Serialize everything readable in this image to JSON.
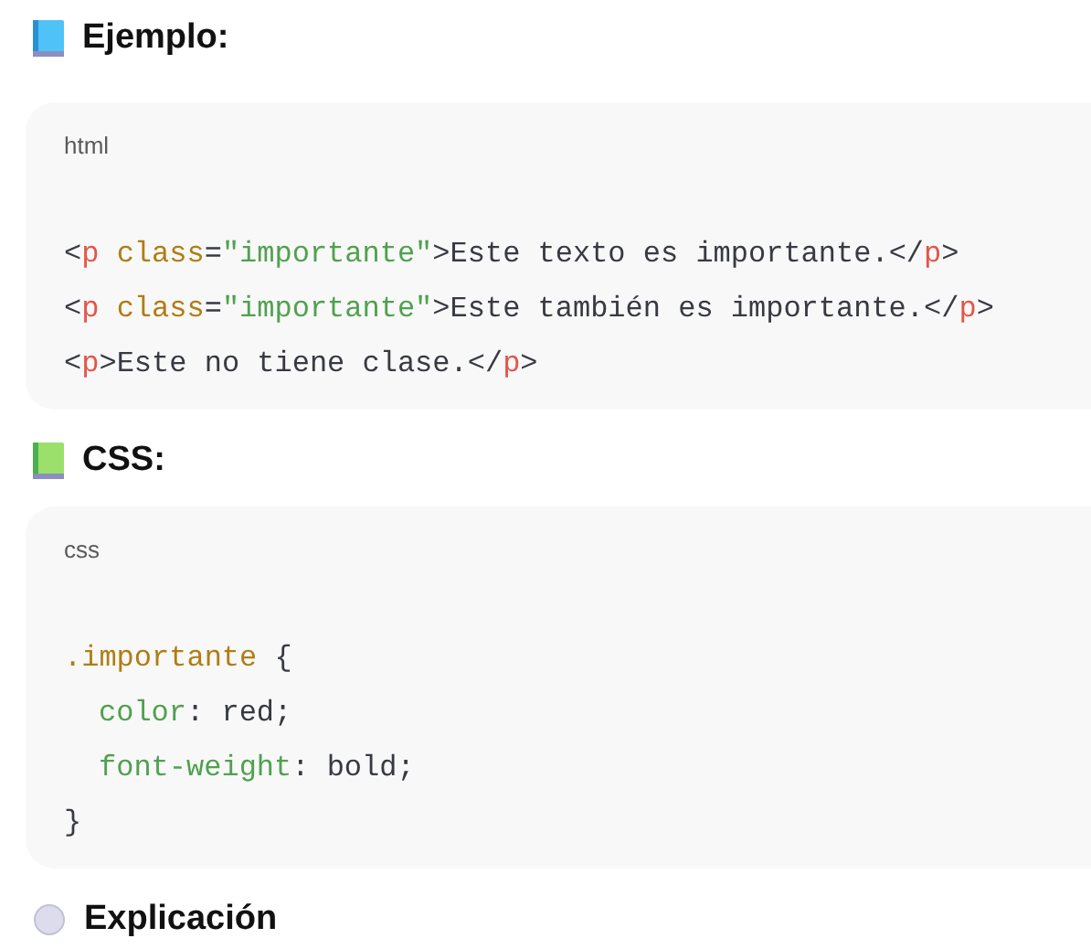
{
  "sections": [
    {
      "heading": "Ejemplo:",
      "code": {
        "language": "html",
        "lines": [
          {
            "indent": false,
            "tokens": [
              {
                "text": "<",
                "kind": "punct"
              },
              {
                "text": "p ",
                "kind": "tag"
              },
              {
                "text": "class",
                "kind": "attr"
              },
              {
                "text": "=",
                "kind": "punct"
              },
              {
                "text": "\"importante\"",
                "kind": "string"
              },
              {
                "text": ">",
                "kind": "punct"
              },
              {
                "text": "Este texto es importante.",
                "kind": "plain"
              },
              {
                "text": "</",
                "kind": "punct"
              },
              {
                "text": "p",
                "kind": "tag"
              },
              {
                "text": ">",
                "kind": "punct"
              }
            ]
          },
          {
            "indent": false,
            "tokens": [
              {
                "text": "<",
                "kind": "punct"
              },
              {
                "text": "p ",
                "kind": "tag"
              },
              {
                "text": "class",
                "kind": "attr"
              },
              {
                "text": "=",
                "kind": "punct"
              },
              {
                "text": "\"importante\"",
                "kind": "string"
              },
              {
                "text": ">",
                "kind": "punct"
              },
              {
                "text": "Este también es importante.",
                "kind": "plain"
              },
              {
                "text": "</",
                "kind": "punct"
              },
              {
                "text": "p",
                "kind": "tag"
              },
              {
                "text": ">",
                "kind": "punct"
              }
            ]
          },
          {
            "indent": false,
            "tokens": [
              {
                "text": "<",
                "kind": "punct"
              },
              {
                "text": "p",
                "kind": "tag"
              },
              {
                "text": ">",
                "kind": "punct"
              },
              {
                "text": "Este no tiene clase.",
                "kind": "plain"
              },
              {
                "text": "</",
                "kind": "punct"
              },
              {
                "text": "p",
                "kind": "tag"
              },
              {
                "text": ">",
                "kind": "punct"
              }
            ]
          }
        ]
      }
    },
    {
      "heading": "CSS:",
      "code": {
        "language": "css",
        "lines": [
          {
            "indent": false,
            "tokens": [
              {
                "text": ".importante",
                "kind": "attr"
              },
              {
                "text": " {",
                "kind": "punct"
              }
            ]
          },
          {
            "indent": true,
            "tokens": [
              {
                "text": "color",
                "kind": "string"
              },
              {
                "text": ": red;",
                "kind": "plain"
              }
            ]
          },
          {
            "indent": true,
            "tokens": [
              {
                "text": "font-weight",
                "kind": "string"
              },
              {
                "text": ": bold;",
                "kind": "plain"
              }
            ]
          },
          {
            "indent": false,
            "tokens": [
              {
                "text": "}",
                "kind": "punct"
              }
            ]
          }
        ]
      }
    },
    {
      "heading": "Explicación"
    }
  ]
}
